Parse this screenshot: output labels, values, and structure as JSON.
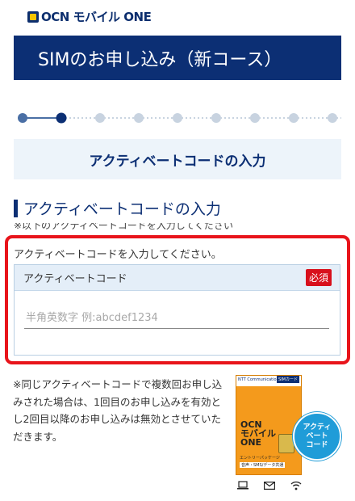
{
  "brand": {
    "logo_text": "OCN モバイル ONE"
  },
  "title_banner": {
    "text": "SIMのお申し込み（新コース）"
  },
  "progress": {
    "total_steps": 11,
    "current_step": 2,
    "colors": {
      "done": "#4a6fa5",
      "current": "#0c2f74",
      "pending": "#c8d3e0"
    }
  },
  "step_header": {
    "text": "アクティベートコードの入力"
  },
  "section": {
    "heading": "アクティベートコードの入力",
    "partial_note": "※以下のアクティベートコードを入力してください"
  },
  "form": {
    "instruction": "アクティベートコードを入力してください。",
    "field_label": "アクティベートコード",
    "required_badge": "必須",
    "placeholder": "半角英数字 例:abcdef1234",
    "value": ""
  },
  "note": {
    "text": "※同じアクティベートコードで複数回お申し込みされた場合は、1回目のお申し込みを有効とし2回目以降のお申し込みは無効とさせていただきます。"
  },
  "package": {
    "maker": "NTT Communications",
    "tag": "SIMカード",
    "brand_line1": "OCN",
    "brand_line2": "モバイル",
    "brand_line3": "ONE",
    "subtitle": "エントリーパッケージ",
    "type": "音声・SMS/データ共通",
    "bubble": "アクティ\nベート\nコード",
    "icons": [
      "laptop-icon",
      "mail-icon",
      "wifi-icon"
    ]
  },
  "colors": {
    "accent": "#0c2f74",
    "highlight": "#e8141b",
    "badge": "#d8101c",
    "bubble": "#1f9cd8"
  }
}
